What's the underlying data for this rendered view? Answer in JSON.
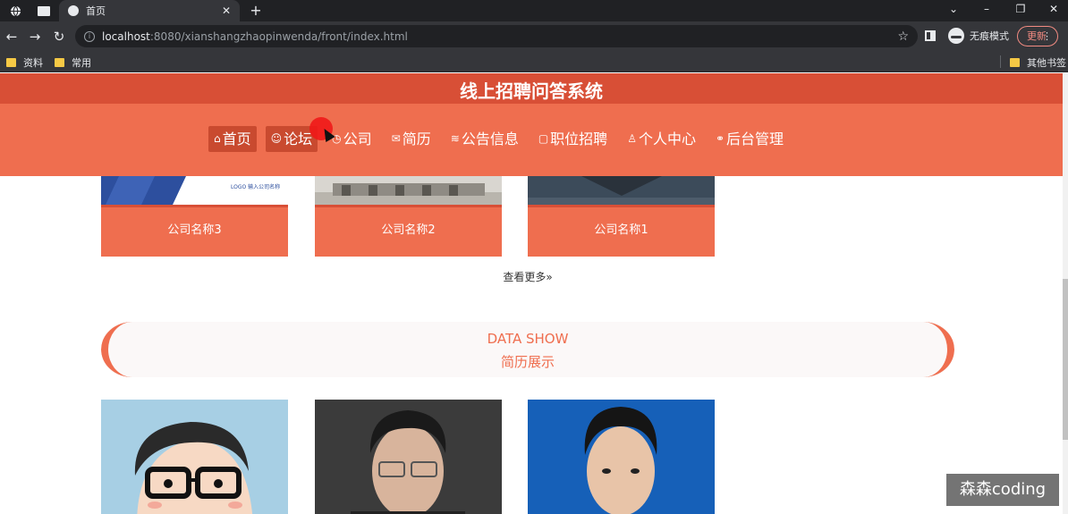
{
  "browser": {
    "active_tab_title": "首页",
    "url_host": "localhost",
    "url_rest": ":8080/xianshangzhaopinwenda/front/index.html",
    "incognito_label": "无痕模式",
    "update_label": "更新",
    "bookmarks": [
      "资料",
      "常用"
    ],
    "other_bookmarks": "其他书签"
  },
  "site": {
    "title": "线上招聘问答系统",
    "nav": [
      {
        "icon": "⌂",
        "label": "首页"
      },
      {
        "icon": "☺",
        "label": "论坛"
      },
      {
        "icon": "◷",
        "label": "公司"
      },
      {
        "icon": "✉",
        "label": "简历"
      },
      {
        "icon": "≋",
        "label": "公告信息"
      },
      {
        "icon": "▢",
        "label": "职位招聘"
      },
      {
        "icon": "♙",
        "label": "个人中心"
      },
      {
        "icon": "⚭",
        "label": "后台管理"
      }
    ]
  },
  "companies": [
    {
      "name": "公司名称3",
      "logo_text": "LOGO 输入公司名称"
    },
    {
      "name": "公司名称2"
    },
    {
      "name": "公司名称1"
    }
  ],
  "more_label": "查看更多",
  "data_show": {
    "en": "DATA SHOW",
    "cn": "简历展示"
  },
  "watermark": "森森coding",
  "colors": {
    "accent": "#ef6e4f",
    "accent_dark": "#d84f36"
  }
}
